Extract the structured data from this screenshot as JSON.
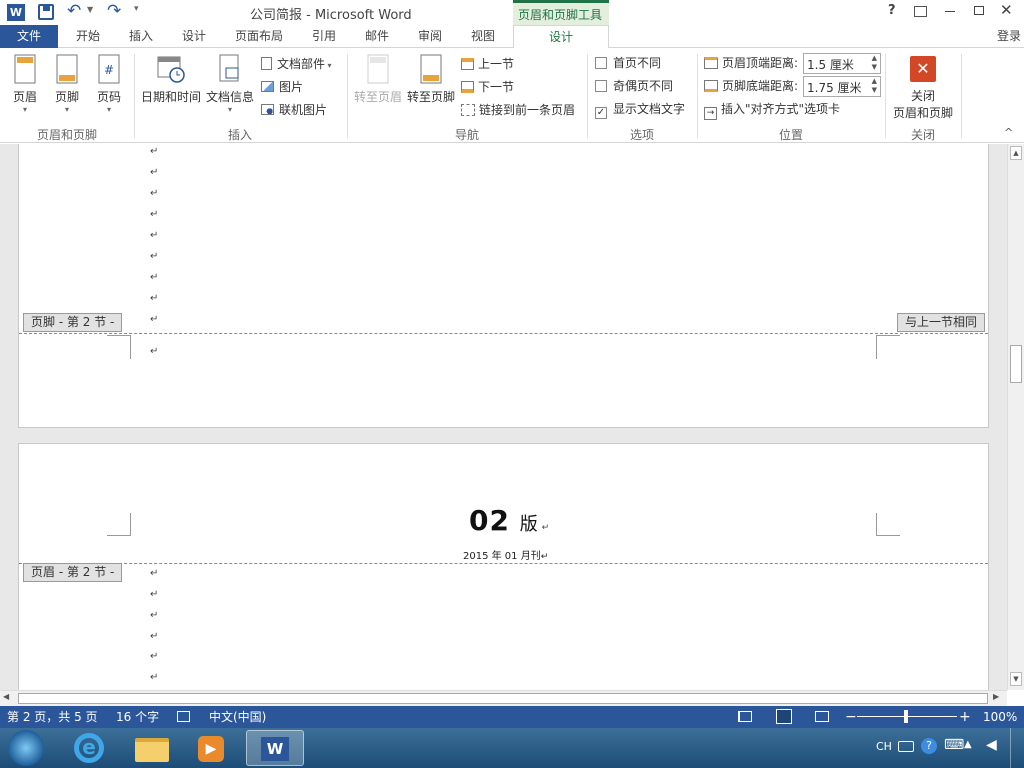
{
  "titlebar": {
    "title": "公司简报 - Microsoft Word",
    "context_tab": "页眉和页脚工具",
    "help": "?"
  },
  "tabs": [
    "文件",
    "开始",
    "插入",
    "设计",
    "页面布局",
    "引用",
    "邮件",
    "审阅",
    "视图",
    "设计"
  ],
  "login": "登录",
  "ribbon": {
    "hf_group": {
      "header": "页眉",
      "footer": "页脚",
      "pagenum": "页码",
      "label": "页眉和页脚"
    },
    "insert_group": {
      "datetime": "日期和时间",
      "docinfo": "文档信息",
      "quickparts": "文档部件",
      "picture": "图片",
      "online_picture": "联机图片",
      "label": "插入"
    },
    "nav_group": {
      "goto_header": "转至页眉",
      "goto_footer": "转至页脚",
      "prev": "上一节",
      "next": "下一节",
      "link_prev": "链接到前一条页眉",
      "label": "导航"
    },
    "options_group": {
      "first_diff": "首页不同",
      "odd_even_diff": "奇偶页不同",
      "show_text": "显示文档文字",
      "label": "选项"
    },
    "position_group": {
      "header_top_label": "页眉顶端距离:",
      "header_top_value": "1.5 厘米",
      "footer_bottom_label": "页脚底端距离:",
      "footer_bottom_value": "1.75 厘米",
      "insert_align_tab": "插入\"对齐方式\"选项卡",
      "label": "位置"
    },
    "close_group": {
      "close_line1": "关闭",
      "close_line2": "页眉和页脚",
      "label": "关闭"
    }
  },
  "document": {
    "return_mark": "↵",
    "footer_tag": "页脚 - 第 2 节 -",
    "same_as_prev": "与上一节相同",
    "header_tag": "页眉 - 第 2 节 -",
    "page2_title_num": "02",
    "page2_title_word": "版",
    "page2_date": "2015 年 01 月刊"
  },
  "status": {
    "page": "第 2 页，共 5 页",
    "words": "16 个字",
    "language": "中文(中国)",
    "zoom": "100%"
  },
  "tray": {
    "lang": "CH"
  },
  "colors": {
    "accent": "#2b579a",
    "context": "#217346",
    "close_red": "#d24726"
  }
}
